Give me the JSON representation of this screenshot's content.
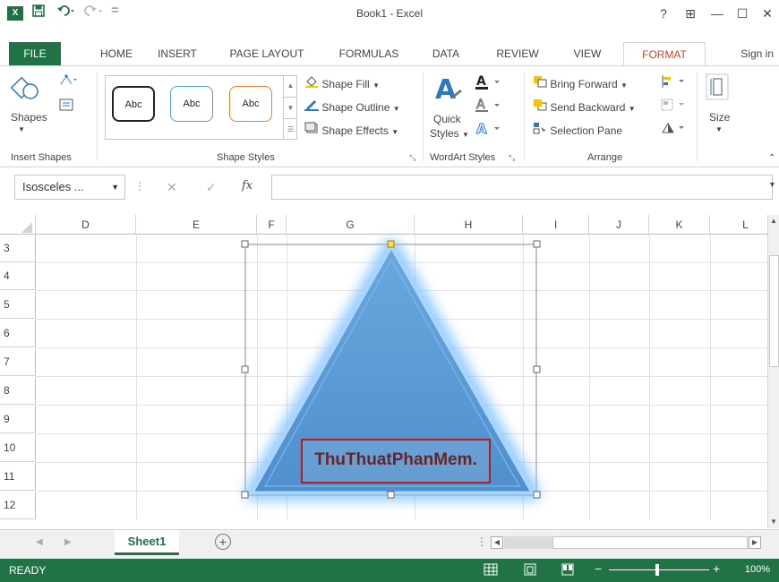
{
  "titlebar": {
    "title": "Book1 - Excel",
    "logo": "X",
    "help": "?",
    "ribbon_display": "⊞",
    "minimize": "—",
    "maximize": "☐",
    "close": "✕",
    "save_icon": "save-icon",
    "undo_icon": "undo-icon",
    "redo_icon": "redo-icon"
  },
  "tabs": [
    {
      "label": "FILE"
    },
    {
      "label": "HOME"
    },
    {
      "label": "INSERT"
    },
    {
      "label": "PAGE LAYOUT"
    },
    {
      "label": "FORMULAS"
    },
    {
      "label": "DATA"
    },
    {
      "label": "REVIEW"
    },
    {
      "label": "VIEW"
    },
    {
      "label": "FORMAT"
    }
  ],
  "signin": "Sign in",
  "ribbon": {
    "insert_shapes": {
      "shapes_label": "Shapes",
      "group": "Insert Shapes"
    },
    "shape_styles": {
      "samples": [
        "Abc",
        "Abc",
        "Abc"
      ],
      "fill": "Shape Fill",
      "outline": "Shape Outline",
      "effects": "Shape Effects",
      "group": "Shape Styles"
    },
    "wordart": {
      "quick_label": "Quick",
      "styles_label": "Styles",
      "group": "WordArt Styles"
    },
    "arrange": {
      "bring_forward": "Bring Forward",
      "send_backward": "Send Backward",
      "selection_pane": "Selection Pane",
      "group": "Arrange"
    },
    "size": {
      "label": "Size"
    }
  },
  "formula_bar": {
    "name_box": "Isosceles ...",
    "cancel": "✕",
    "enter": "✓",
    "fx": "fx"
  },
  "columns": [
    "D",
    "E",
    "F",
    "G",
    "H",
    "I",
    "J",
    "K",
    "L"
  ],
  "rows": [
    "3",
    "4",
    "5",
    "6",
    "7",
    "8",
    "9",
    "10",
    "11",
    "12"
  ],
  "shape": {
    "text": "ThuThuatPhanMem.",
    "fill_color": "#5b9bd5",
    "glow_color": "#6fb3f0"
  },
  "sheets": [
    {
      "label": "Sheet1"
    }
  ],
  "status": {
    "ready": "READY",
    "zoom": "100%"
  },
  "colors": {
    "accent": "#217346",
    "format_tab": "#d24726"
  }
}
